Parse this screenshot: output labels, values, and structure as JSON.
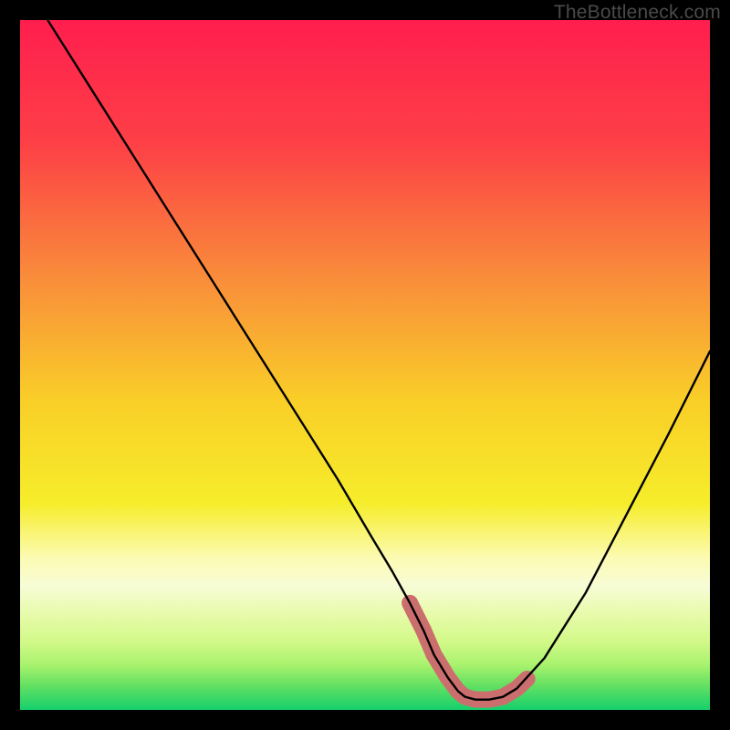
{
  "watermark": "TheBottleneck.com",
  "chart_data": {
    "type": "line",
    "title": "",
    "xlabel": "",
    "ylabel": "",
    "xlim": [
      0,
      100
    ],
    "ylim": [
      0,
      100
    ],
    "grid": false,
    "legend": false,
    "gradient_stops": [
      {
        "offset": 0.0,
        "color": "#FF1E4E"
      },
      {
        "offset": 0.18,
        "color": "#FD4046"
      },
      {
        "offset": 0.38,
        "color": "#F98F3A"
      },
      {
        "offset": 0.55,
        "color": "#F9CE28"
      },
      {
        "offset": 0.7,
        "color": "#F6ED2A"
      },
      {
        "offset": 0.78,
        "color": "#FCFBB3"
      },
      {
        "offset": 0.82,
        "color": "#F7FCD6"
      },
      {
        "offset": 0.86,
        "color": "#E8FBAC"
      },
      {
        "offset": 0.9,
        "color": "#D3F989"
      },
      {
        "offset": 0.935,
        "color": "#A8F26D"
      },
      {
        "offset": 0.965,
        "color": "#62E062"
      },
      {
        "offset": 1.0,
        "color": "#15D06C"
      }
    ],
    "series": [
      {
        "name": "bottleneck-curve",
        "stroke": "#000000",
        "stroke_width": 2.4,
        "x": [
          4,
          10,
          16,
          22,
          28,
          34,
          40,
          46,
          51,
          54,
          56.5,
          58.5,
          60,
          62,
          63.5,
          64.5,
          66,
          68,
          70,
          72,
          76,
          82,
          88,
          94,
          100
        ],
        "y": [
          100,
          90.5,
          81,
          71.5,
          62,
          52.5,
          43,
          33.5,
          25,
          20,
          15.5,
          11.5,
          8,
          4.7,
          2.7,
          1.9,
          1.5,
          1.5,
          1.9,
          3.1,
          7.5,
          17,
          28.5,
          40,
          52
        ]
      }
    ],
    "highlight_segment": {
      "stroke": "#CB6F6E",
      "stroke_width": 18,
      "x": [
        56.5,
        58.5,
        60,
        62,
        63.5,
        64.5,
        66,
        68,
        70,
        72,
        73.5
      ],
      "y": [
        15.5,
        11.5,
        8,
        4.7,
        2.7,
        1.9,
        1.5,
        1.5,
        1.9,
        3.1,
        4.5
      ]
    }
  }
}
